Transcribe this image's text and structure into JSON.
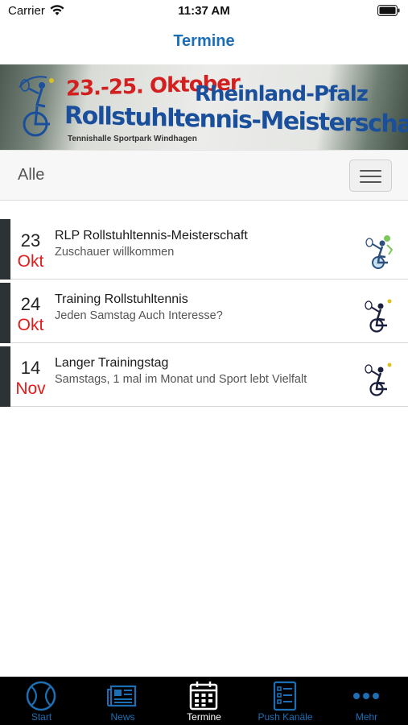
{
  "status_bar": {
    "carrier": "Carrier",
    "time": "11:37 AM"
  },
  "nav": {
    "title": "Termine"
  },
  "banner": {
    "date_text": "23.-25. Oktober",
    "region_text": "Rheinland-Pfalz",
    "title_text": "Rollstuhltennis-Meisterschaft",
    "venue_text": "Tennishalle Sportpark Windhagen"
  },
  "filter": {
    "label": "Alle"
  },
  "events": [
    {
      "day": "23",
      "month": "Okt",
      "title": "RLP Rollstuhltennis-Meisterschaft",
      "subtitle": "Zuschauer willkommen",
      "thumb_icon": "wheelchair-tennis-color-icon"
    },
    {
      "day": "24",
      "month": "Okt",
      "title": "Training Rollstuhltennis",
      "subtitle": "Jeden Samstag Auch Interesse?",
      "thumb_icon": "wheelchair-tennis-icon"
    },
    {
      "day": "14",
      "month": "Nov",
      "title": "Langer Trainingstag",
      "subtitle": "Samstags, 1 mal im Monat und Sport lebt Vielfalt",
      "thumb_icon": "wheelchair-tennis-icon"
    }
  ],
  "tabs": [
    {
      "label": "Start",
      "icon": "tennis-ball-icon"
    },
    {
      "label": "News",
      "icon": "newspaper-icon"
    },
    {
      "label": "Termine",
      "icon": "calendar-icon",
      "active": true
    },
    {
      "label": "Push Kanäle",
      "icon": "checklist-icon"
    },
    {
      "label": "Mehr",
      "icon": "more-dots-icon"
    }
  ],
  "colors": {
    "accent": "#1c6fb5",
    "month_red": "#e21b1b",
    "tab_bar_bg": "#000000",
    "row_marker": "#2d3236"
  }
}
